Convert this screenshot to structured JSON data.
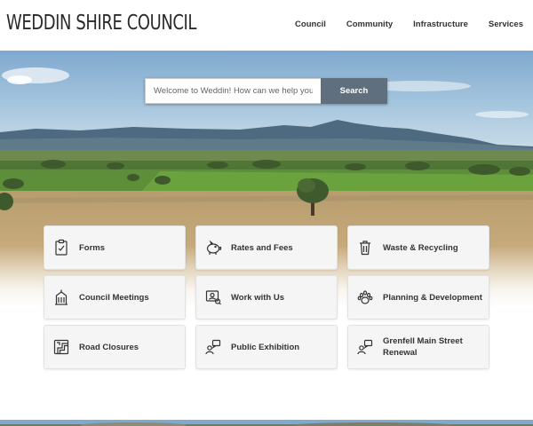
{
  "header": {
    "site_title": "WEDDIN SHIRE COUNCIL",
    "nav": [
      "Council",
      "Community",
      "Infrastructure",
      "Services"
    ]
  },
  "search": {
    "placeholder": "Welcome to Weddin! How can we help you?",
    "button_label": "Search"
  },
  "tiles": [
    {
      "label": "Forms",
      "icon": "clipboard-check-icon"
    },
    {
      "label": "Rates and Fees",
      "icon": "piggy-bank-icon"
    },
    {
      "label": "Waste & Recycling",
      "icon": "trash-bin-icon"
    },
    {
      "label": "Council Meetings",
      "icon": "building-icon"
    },
    {
      "label": "Work with Us",
      "icon": "job-search-icon"
    },
    {
      "label": "Planning & Development",
      "icon": "paw-icon"
    },
    {
      "label": "Road Closures",
      "icon": "road-map-icon"
    },
    {
      "label": "Public Exhibition",
      "icon": "speech-person-icon"
    },
    {
      "label": "Grenfell Main Street Renewal",
      "icon": "speech-person-icon"
    }
  ],
  "colors": {
    "search_button": "#5f6f7e",
    "tile_background": "#f5f5f5",
    "sky": "#9fc3dc",
    "field_green": "#5b8a3a",
    "dry_grass": "#c9ad7e"
  }
}
